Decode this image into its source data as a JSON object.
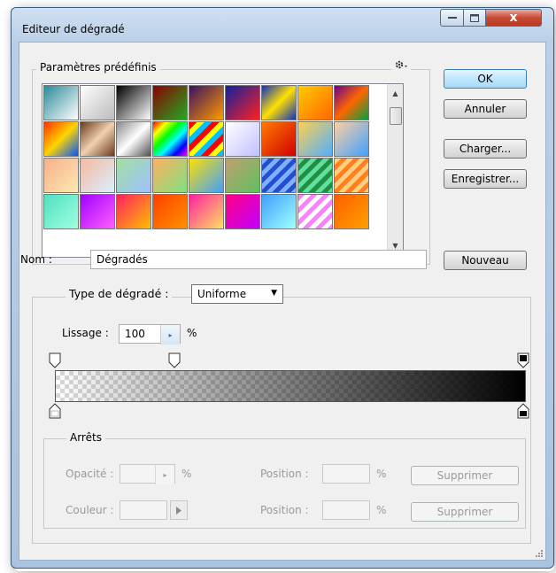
{
  "window": {
    "title": "Editeur de dégradé",
    "minimize_icon": "minimize-icon",
    "maximize_icon": "maximize-icon",
    "close_label": "x"
  },
  "presets": {
    "legend": "Paramètres prédéfinis",
    "menu_icon": "gear-icon",
    "swatches": [
      "linear-gradient(135deg,#2a8a9a,#ffffff)",
      "linear-gradient(135deg,#ffffff,#bbbbbb)",
      "linear-gradient(135deg,#000000,#ffffff)",
      "linear-gradient(135deg,#8b0000,#22aa22)",
      "linear-gradient(135deg,#3a1060,#ff9a00)",
      "linear-gradient(135deg,#1020a0,#ff2020)",
      "linear-gradient(135deg,#1030c0,#ffe000,#1030c0)",
      "linear-gradient(135deg,#ffcc00,#ff6600)",
      "linear-gradient(135deg,#6a008a,#ff6600,#00a040)",
      "linear-gradient(135deg,#ff3300,#ffd400,#0055ff)",
      "linear-gradient(135deg,#6b3a1c,#f0d0b0,#6b3a1c)",
      "linear-gradient(135deg,#8a8a8a,#ffffff,#505050)",
      "linear-gradient(135deg,#ff0000,#ffff00,#00ff00,#00ffff,#0000ff,#ff00ff)",
      "repeating-linear-gradient(135deg,#ff0000 0 6px,#ffff00 6px 12px,#00c0ff 12px 18px)",
      "linear-gradient(135deg,#ffffff,#c0c0ff)",
      "linear-gradient(135deg,#ff7a00,#d00000)",
      "linear-gradient(135deg,#ffd050,#50b0ff)",
      "linear-gradient(135deg,#ffd0a0,#40a0ff)",
      "linear-gradient(135deg,#f5b08a,#ffe8b0)",
      "linear-gradient(135deg,#f8b8a0,#d8f0ff)",
      "linear-gradient(135deg,#a0e0a0,#a0c0ff)",
      "linear-gradient(135deg,#ffb060,#80e080)",
      "linear-gradient(135deg,#ffe000,#40a0ff)",
      "linear-gradient(135deg,#c0a070,#60c060)",
      "repeating-linear-gradient(135deg,#80b0ff 0 5px,#2050d0 5px 10px)",
      "repeating-linear-gradient(135deg,#60e0a0 0 5px,#209040 5px 10px)",
      "repeating-linear-gradient(135deg,#ffd080 0 5px,#ff8020 5px 10px)",
      "linear-gradient(135deg,#50e0c0,#a0ffe0)",
      "linear-gradient(135deg,#a000ff,#ff60ff)",
      "linear-gradient(135deg,#ff2060,#ffc000)",
      "linear-gradient(135deg,#ff4000,#ff9000)",
      "linear-gradient(135deg,#ff20a0,#ffe060)",
      "linear-gradient(135deg,#ff0080,#c000ff)",
      "linear-gradient(135deg,#40a0ff,#a0ffff)",
      "repeating-linear-gradient(135deg,#ff80ff 0 5px,#ffffff 5px 10px)",
      "linear-gradient(135deg,#ff6000,#ffa000)"
    ]
  },
  "buttons": {
    "ok": "OK",
    "cancel": "Annuler",
    "load": "Charger...",
    "save": "Enregistrer...",
    "new": "Nouveau"
  },
  "name": {
    "label": "Nom :",
    "value": "Dégradés"
  },
  "gradient": {
    "type_label": "Type de dégradé :",
    "type_value": "Uniforme",
    "smoothness_label": "Lissage :",
    "smoothness_value": "100",
    "smoothness_unit": "%",
    "start_color": "#ffffff",
    "end_color": "#000000"
  },
  "stops": {
    "legend": "Arrêts",
    "opacity_label": "Opacité :",
    "opacity_value": "",
    "opacity_unit": "%",
    "color_label": "Couleur :",
    "position_label": "Position :",
    "position_unit": "%",
    "position_value_1": "",
    "position_value_2": "",
    "delete_label": "Supprimer"
  }
}
